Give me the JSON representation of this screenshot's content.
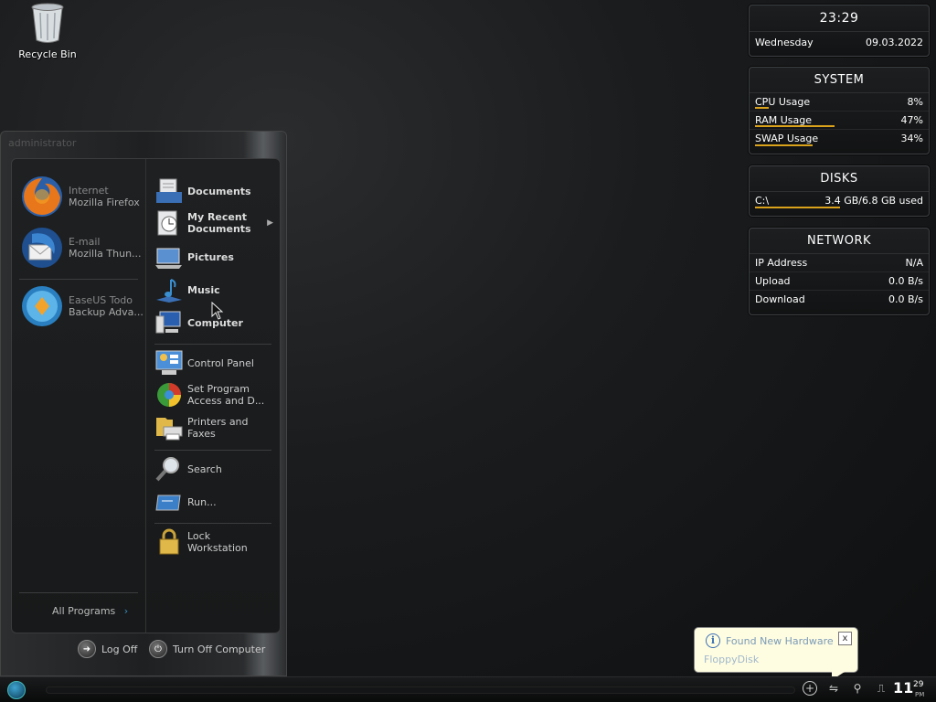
{
  "desktop": {
    "recycle_bin_label": "Recycle Bin"
  },
  "widgets": {
    "clock": {
      "time": "23:29",
      "day": "Wednesday",
      "date": "09.03.2022"
    },
    "system": {
      "title": "SYSTEM",
      "rows": [
        {
          "label": "CPU Usage",
          "value": "8%",
          "fraction": 0.08
        },
        {
          "label": "RAM Usage",
          "value": "47%",
          "fraction": 0.47
        },
        {
          "label": "SWAP Usage",
          "value": "34%",
          "fraction": 0.34
        }
      ]
    },
    "disks": {
      "title": "DISKS",
      "rows": [
        {
          "label": "C:\\",
          "value": "3.4 GB/6.8 GB used",
          "fraction": 0.5
        }
      ]
    },
    "network": {
      "title": "NETWORK",
      "rows": [
        {
          "label": "IP Address",
          "value": "N/A"
        },
        {
          "label": "Upload",
          "value": "0.0 B/s"
        },
        {
          "label": "Download",
          "value": "0.0 B/s"
        }
      ]
    }
  },
  "start_menu": {
    "user": "administrator",
    "pinned": [
      {
        "line1": "Internet",
        "line2": "Mozilla Firefox",
        "icon": "firefox-icon"
      },
      {
        "line1": "E-mail",
        "line2": "Mozilla Thun...",
        "icon": "thunderbird-icon"
      },
      {
        "line1": "EaseUS Todo",
        "line2": "Backup Adva...",
        "icon": "easeus-icon"
      }
    ],
    "all_programs": "All Programs",
    "right_items": [
      {
        "label": "Documents",
        "bold": true,
        "icon": "documents-icon"
      },
      {
        "label1": "My Recent",
        "label2": "Documents",
        "bold": true,
        "icon": "recent-documents-icon"
      },
      {
        "label": "Pictures",
        "bold": true,
        "icon": "pictures-icon"
      },
      {
        "label": "Music",
        "bold": true,
        "icon": "music-icon"
      },
      {
        "label": "Computer",
        "bold": true,
        "icon": "computer-icon"
      },
      {
        "label": "Control Panel",
        "icon": "control-panel-icon"
      },
      {
        "label1": "Set Program",
        "label2": "Access and D...",
        "icon": "set-program-access-icon"
      },
      {
        "label1": "Printers and",
        "label2": "Faxes",
        "icon": "printers-icon"
      },
      {
        "label": "Search",
        "icon": "search-icon"
      },
      {
        "label": "Run...",
        "icon": "run-icon"
      },
      {
        "label1": "Lock",
        "label2": "Workstation",
        "icon": "lock-icon"
      }
    ],
    "log_off": "Log Off",
    "turn_off": "Turn Off Computer"
  },
  "notification": {
    "title": "Found New Hardware",
    "body": "FloppyDisk",
    "close": "x"
  },
  "taskbar": {
    "clock_hour": "11",
    "clock_min": "29",
    "clock_ampm": "PM"
  }
}
